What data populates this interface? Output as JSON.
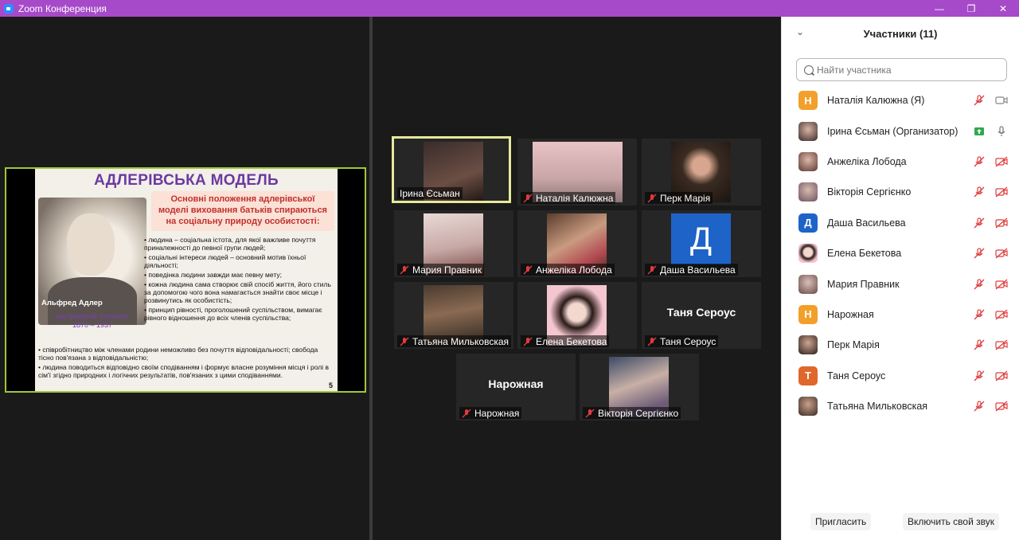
{
  "window": {
    "title": "Zoom Конференция",
    "min": "—",
    "max": "❐",
    "close": "✕"
  },
  "slide": {
    "title": "АДЛЕРІВСЬКА МОДЕЛЬ",
    "box_l1": "Основні положення адлерівської",
    "box_l2": "моделі виховання батьків спираються",
    "box_l3": "на соціальну природу особистості:",
    "caption": "Альфред Адлер",
    "sub1": "австрийский психолог",
    "sub2": "1870 – 1937",
    "b1": "• людина – соціальна істота, для якої важливе почуття приналежності до певної групи людей;",
    "b2": "• соціальні інтереси людей – основний мотив їхньої діяльності;",
    "b3": "• поведінка людини завжди має певну мету;",
    "b4": "• кожна людина сама створює свій спосіб життя, його стиль за допомогою чого вона намагається знайти своє місце і розвинутись як особистість;",
    "b5": "• принцип рівності, проголошений суспільством, вимагає рівного відношення до всіх членів суспільства;",
    "b6": "• співробітництво між членами родини неможливо без почуття відповідальності; свобода тісно пов'язана з відповідальністю;",
    "b7": "• людина поводиться відповідно своїм сподіванням і формує власне розуміння місця і ролі в сім'ї згідно природних і логічних результатів, пов'язаних з цими сподіваннями.",
    "page": "5"
  },
  "tiles": [
    {
      "name": "Ірина Єсьман"
    },
    {
      "name": "Наталія Калюжна"
    },
    {
      "name": "Перк Марія"
    },
    {
      "name": "Мария Правник"
    },
    {
      "name": "Анжеліка Лобода"
    },
    {
      "name": "Даша Васильева",
      "initial": "Д"
    },
    {
      "name": "Татьяна Мильковская"
    },
    {
      "name": "Елена Бекетова"
    },
    {
      "name": "Таня Сероус",
      "center": "Таня Сероус"
    },
    {
      "name": "Нарожная",
      "center": "Нарожная"
    },
    {
      "name": "Вікторія Сергієнко"
    }
  ],
  "panel": {
    "title": "Участники (11)",
    "search_placeholder": "Найти участника",
    "participants": [
      {
        "name": "Наталія Калюжна (Я)",
        "initial": "Н",
        "color": "#f2a02b"
      },
      {
        "name": "Ірина Єсьман (Организатор)"
      },
      {
        "name": "Анжеліка Лобода"
      },
      {
        "name": "Вікторія Сергієнко"
      },
      {
        "name": "Даша Васильева",
        "initial": "Д",
        "color": "#1e63c8"
      },
      {
        "name": "Елена Бекетова"
      },
      {
        "name": "Мария Правник"
      },
      {
        "name": "Нарожная",
        "initial": "Н",
        "color": "#f2a02b"
      },
      {
        "name": "Перк Марія"
      },
      {
        "name": "Таня Сероус",
        "initial": "Т",
        "color": "#e0672b"
      },
      {
        "name": "Татьяна Мильковская"
      }
    ],
    "invite": "Пригласить",
    "unmute": "Включить свой звук"
  }
}
